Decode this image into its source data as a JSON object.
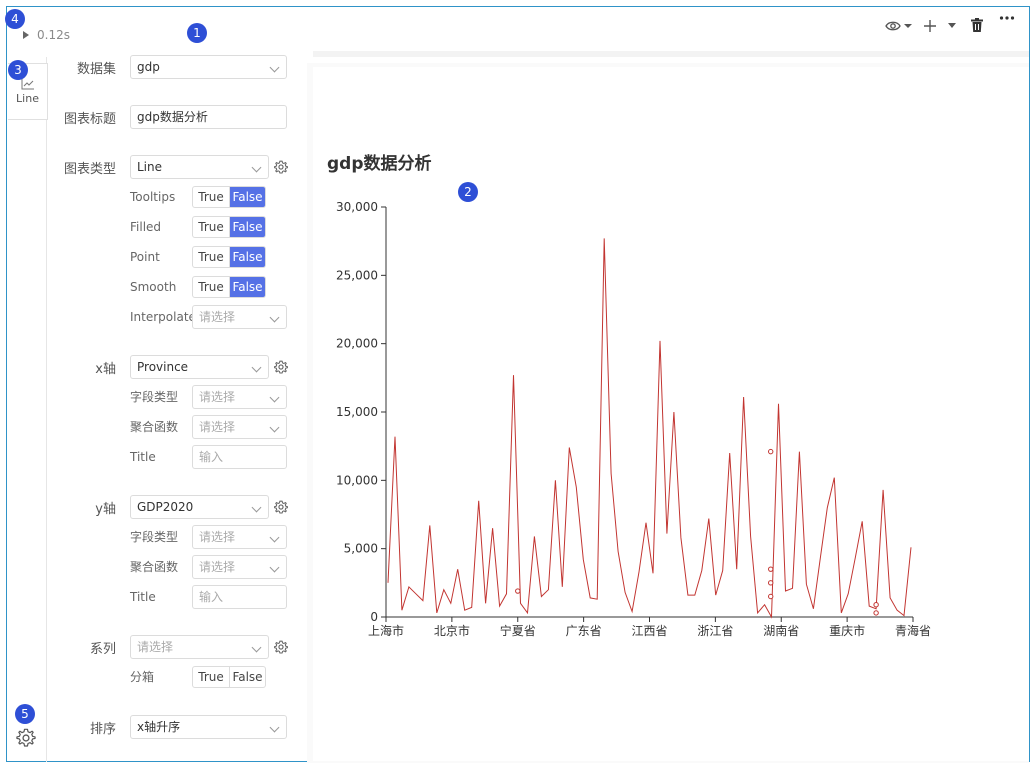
{
  "timing": "0.12s",
  "badges": [
    "1",
    "2",
    "3",
    "4",
    "5"
  ],
  "sidebar": {
    "tab_label": "Line"
  },
  "config": {
    "dataset_label": "数据集",
    "dataset_value": "gdp",
    "title_label": "图表标题",
    "title_value": "gdp数据分析",
    "charttype_label": "图表类型",
    "charttype_value": "Line",
    "options": [
      {
        "label": "Tooltips",
        "true": "True",
        "false": "False",
        "selected": "False"
      },
      {
        "label": "Filled",
        "true": "True",
        "false": "False",
        "selected": "False"
      },
      {
        "label": "Point",
        "true": "True",
        "false": "False",
        "selected": "False"
      },
      {
        "label": "Smooth",
        "true": "True",
        "false": "False",
        "selected": "False"
      }
    ],
    "interpolate_label": "Interpolate",
    "interpolate_placeholder": "请选择",
    "x_label": "x轴",
    "x_value": "Province",
    "x_fieldtype_label": "字段类型",
    "x_fieldtype_placeholder": "请选择",
    "x_agg_label": "聚合函数",
    "x_agg_placeholder": "请选择",
    "x_title_label": "Title",
    "x_title_placeholder": "输入",
    "y_label": "y轴",
    "y_value": "GDP2020",
    "y_fieldtype_label": "字段类型",
    "y_fieldtype_placeholder": "请选择",
    "y_agg_label": "聚合函数",
    "y_agg_placeholder": "请选择",
    "y_title_label": "Title",
    "y_title_placeholder": "输入",
    "series_label": "系列",
    "series_placeholder": "请选择",
    "bin_label": "分箱",
    "bin_true": "True",
    "bin_false": "False",
    "bin_selected": "none",
    "sort_label": "排序",
    "sort_value": "x轴升序"
  },
  "colors": {
    "accent": "#5571e6",
    "line": "#c23531",
    "badge": "#2e4fd6",
    "frame": "#2f93c8"
  },
  "chart_data": {
    "type": "line",
    "title": "gdp数据分析",
    "xlabel": "",
    "ylabel": "",
    "ylim": [
      0,
      30000
    ],
    "yticks": [
      "0",
      "5,000",
      "10,000",
      "15,000",
      "20,000",
      "25,000",
      "30,000"
    ],
    "xtick_labels": [
      "上海市",
      "北京市",
      "宁夏省",
      "广东省",
      "江西省",
      "浙江省",
      "湖南省",
      "重庆市",
      "青海省"
    ],
    "n_points": 268,
    "series": [
      {
        "values": [
          2500,
          13200,
          500,
          2200,
          1700,
          1200,
          6700,
          300,
          2000,
          1000,
          3500,
          500,
          700,
          8500,
          1000,
          6500,
          800,
          1700,
          17700,
          1000,
          300,
          5900,
          1500,
          2000,
          10000,
          2200,
          12400,
          9500,
          4200,
          1400,
          1300,
          27700,
          10500,
          4800,
          1800,
          400,
          3300,
          6900,
          3200,
          20200,
          6100,
          15000,
          5800,
          1600,
          1600,
          3400,
          7200,
          1600,
          3400,
          12000,
          3500,
          16100,
          5900,
          300,
          900,
          0,
          15600,
          1900,
          2100,
          12100,
          2400,
          600,
          4300,
          8000,
          10200,
          300,
          1700,
          4300,
          7000,
          800,
          600,
          9300,
          1400,
          500,
          100,
          5100
        ]
      }
    ]
  }
}
